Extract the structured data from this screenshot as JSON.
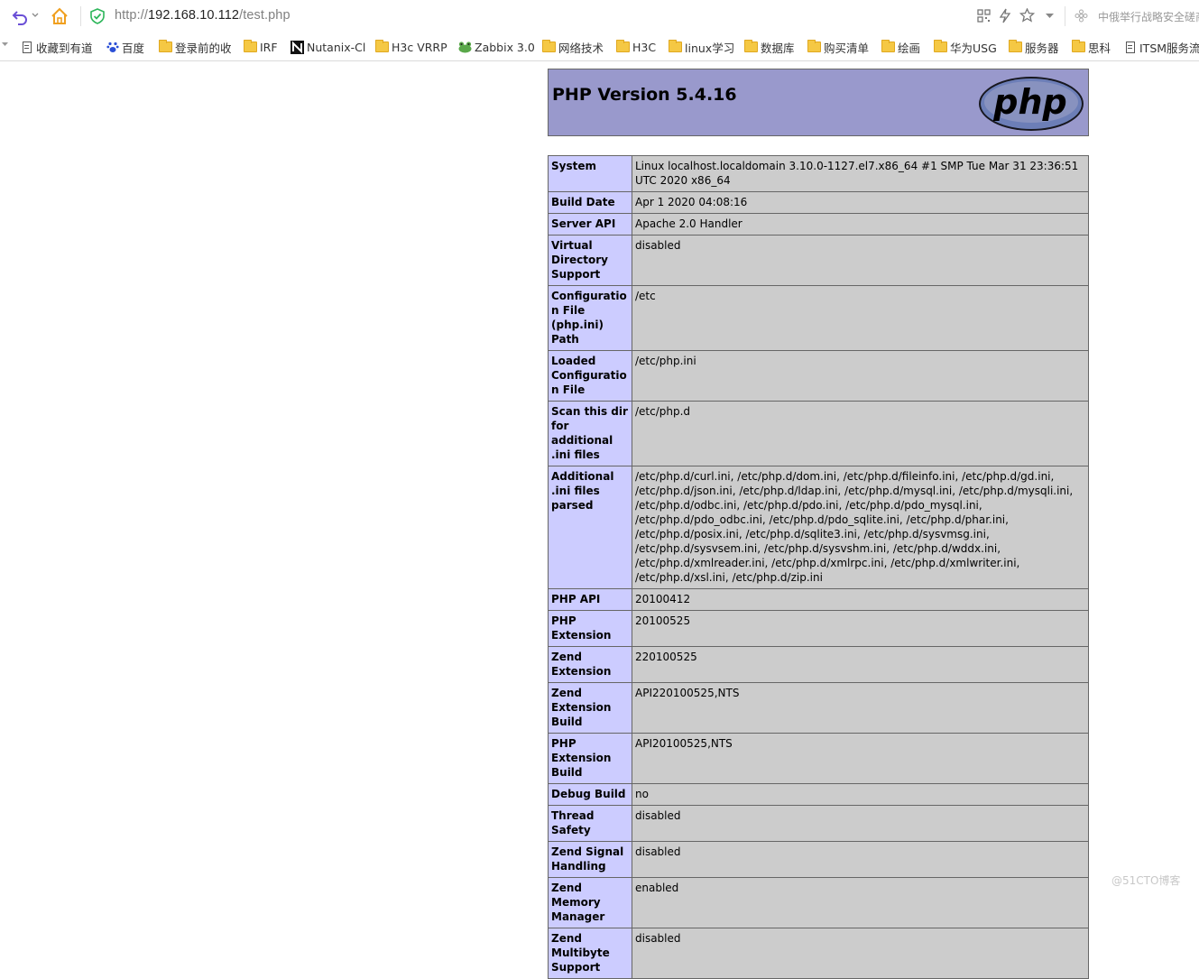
{
  "browser": {
    "url_scheme": "http://",
    "url_host": "192.168.10.112",
    "url_path": "/test.php",
    "right_text": "中俄举行战略安全磋商",
    "bookmarks": [
      {
        "label": "收藏到有道",
        "icon": "document-icon"
      },
      {
        "label": "百度",
        "icon": "baidu-paw-icon"
      },
      {
        "label": "登录前的收",
        "icon": "folder-icon"
      },
      {
        "label": "IRF",
        "icon": "folder-icon"
      },
      {
        "label": "Nutanix-Cl",
        "icon": "nutanix-icon"
      },
      {
        "label": "H3c VRRP",
        "icon": "folder-icon"
      },
      {
        "label": "Zabbix 3.0",
        "icon": "frog-icon"
      },
      {
        "label": "网络技术",
        "icon": "folder-icon"
      },
      {
        "label": "H3C",
        "icon": "folder-icon"
      },
      {
        "label": "linux学习",
        "icon": "folder-icon"
      },
      {
        "label": "数据库",
        "icon": "folder-icon"
      },
      {
        "label": "购买清单",
        "icon": "folder-icon"
      },
      {
        "label": "绘画",
        "icon": "folder-icon"
      },
      {
        "label": "华为USG",
        "icon": "folder-icon"
      },
      {
        "label": "服务器",
        "icon": "folder-icon"
      },
      {
        "label": "思科",
        "icon": "folder-icon"
      },
      {
        "label": "ITSM服务流",
        "icon": "document-icon"
      }
    ]
  },
  "phpinfo": {
    "title": "PHP Version 5.4.16",
    "logo_text": "php",
    "rows": [
      {
        "key": "System",
        "value": "Linux localhost.localdomain 3.10.0-1127.el7.x86_64 #1 SMP Tue Mar 31 23:36:51 UTC 2020 x86_64"
      },
      {
        "key": "Build Date",
        "value": "Apr 1 2020 04:08:16"
      },
      {
        "key": "Server API",
        "value": "Apache 2.0 Handler"
      },
      {
        "key": "Virtual Directory Support",
        "value": "disabled"
      },
      {
        "key": "Configuration File (php.ini) Path",
        "value": "/etc"
      },
      {
        "key": "Loaded Configuration File",
        "value": "/etc/php.ini"
      },
      {
        "key": "Scan this dir for additional .ini files",
        "value": "/etc/php.d"
      },
      {
        "key": "Additional .ini files parsed",
        "value": "/etc/php.d/curl.ini, /etc/php.d/dom.ini, /etc/php.d/fileinfo.ini, /etc/php.d/gd.ini, /etc/php.d/json.ini, /etc/php.d/ldap.ini, /etc/php.d/mysql.ini, /etc/php.d/mysqli.ini, /etc/php.d/odbc.ini, /etc/php.d/pdo.ini, /etc/php.d/pdo_mysql.ini, /etc/php.d/pdo_odbc.ini, /etc/php.d/pdo_sqlite.ini, /etc/php.d/phar.ini, /etc/php.d/posix.ini, /etc/php.d/sqlite3.ini, /etc/php.d/sysvmsg.ini, /etc/php.d/sysvsem.ini, /etc/php.d/sysvshm.ini, /etc/php.d/wddx.ini, /etc/php.d/xmlreader.ini, /etc/php.d/xmlrpc.ini, /etc/php.d/xmlwriter.ini, /etc/php.d/xsl.ini, /etc/php.d/zip.ini"
      },
      {
        "key": "PHP API",
        "value": "20100412"
      },
      {
        "key": "PHP Extension",
        "value": "20100525"
      },
      {
        "key": "Zend Extension",
        "value": "220100525"
      },
      {
        "key": "Zend Extension Build",
        "value": "API220100525,NTS"
      },
      {
        "key": "PHP Extension Build",
        "value": "API20100525,NTS"
      },
      {
        "key": "Debug Build",
        "value": "no"
      },
      {
        "key": "Thread Safety",
        "value": "disabled"
      },
      {
        "key": "Zend Signal Handling",
        "value": "disabled"
      },
      {
        "key": "Zend Memory Manager",
        "value": "enabled"
      },
      {
        "key": "Zend Multibyte Support",
        "value": "disabled"
      }
    ]
  },
  "watermark": "@51CTO博客",
  "colors": {
    "header_bg": "#9999cc",
    "key_bg": "#ccccff",
    "value_bg": "#cccccc",
    "border": "#666666"
  }
}
